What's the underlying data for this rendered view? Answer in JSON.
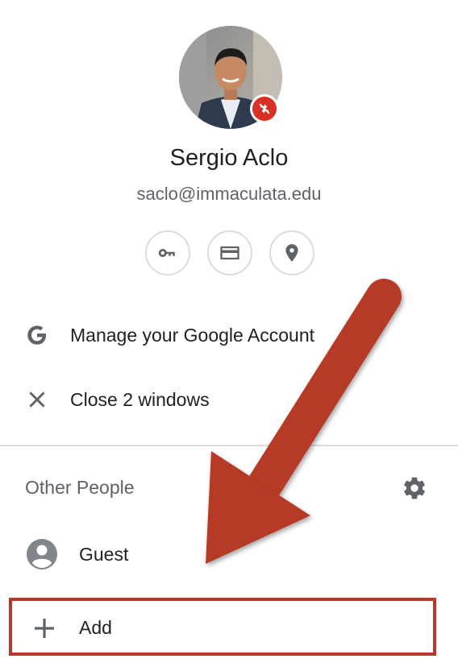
{
  "profile": {
    "name": "Sergio Aclo",
    "email": "saclo@immaculata.edu",
    "sync_status_icon": "sync-disabled-icon"
  },
  "quick_actions": [
    {
      "icon": "key-icon",
      "name": "passwords"
    },
    {
      "icon": "credit-card-icon",
      "name": "payment-methods"
    },
    {
      "icon": "location-pin-icon",
      "name": "addresses"
    }
  ],
  "menu": {
    "manage_account": "Manage your Google Account",
    "close_windows": "Close 2 windows"
  },
  "other_people": {
    "title": "Other People",
    "guest_label": "Guest",
    "add_label": "Add"
  },
  "colors": {
    "annotation_arrow": "#b53a28",
    "sync_badge": "#d93025",
    "icon_gray": "#5f6368"
  }
}
